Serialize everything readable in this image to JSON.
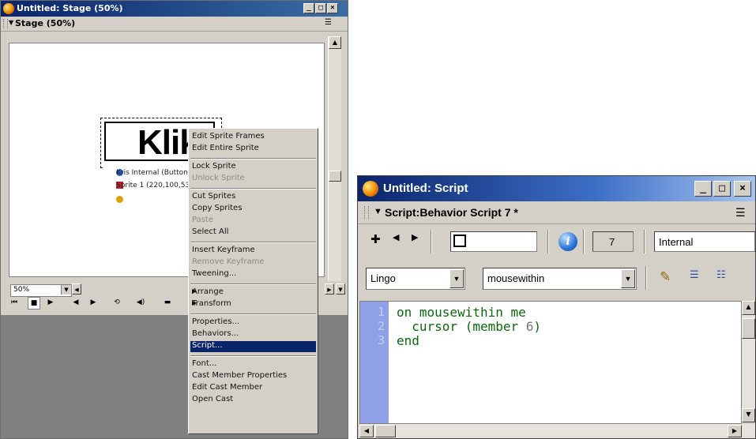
{
  "stage_window": {
    "title": "Untitled: Stage (50%)",
    "panel_title": "Stage (50%)",
    "sprite_text": "Klik",
    "sprite_info": {
      "name": "Kris Internal (Button",
      "coords": "Sprite 1 (220,100,532,3",
      "extra": ""
    },
    "zoom_value": "50%",
    "buttons": {
      "minimize": "_",
      "maximize": "□",
      "close": "×"
    }
  },
  "context_menu": {
    "items": [
      {
        "label": "Edit Sprite Frames",
        "enabled": true
      },
      {
        "label": "Edit Entire Sprite",
        "enabled": true
      },
      {
        "separator": true
      },
      {
        "label": "Lock Sprite",
        "enabled": true
      },
      {
        "label": "Unlock Sprite",
        "enabled": false
      },
      {
        "separator": true
      },
      {
        "label": "Cut Sprites",
        "enabled": true
      },
      {
        "label": "Copy Sprites",
        "enabled": true
      },
      {
        "label": "Paste",
        "enabled": false
      },
      {
        "label": "Select All",
        "enabled": true
      },
      {
        "separator": true
      },
      {
        "label": "Insert Keyframe",
        "enabled": true
      },
      {
        "label": "Remove Keyframe",
        "enabled": false
      },
      {
        "label": "Tweening...",
        "enabled": true
      },
      {
        "separator": true
      },
      {
        "label": "Arrange",
        "enabled": true,
        "submenu": true
      },
      {
        "label": "Transform",
        "enabled": true,
        "submenu": true
      },
      {
        "separator": true
      },
      {
        "label": "Properties...",
        "enabled": true
      },
      {
        "label": "Behaviors...",
        "enabled": true
      },
      {
        "label": "Script...",
        "enabled": true,
        "selected": true
      },
      {
        "separator": true
      },
      {
        "label": "Font...",
        "enabled": true
      },
      {
        "label": "Cast Member Properties",
        "enabled": true
      },
      {
        "label": "Edit Cast Member",
        "enabled": true
      },
      {
        "label": "Open Cast",
        "enabled": true
      }
    ]
  },
  "script_window": {
    "title": "Untitled: Script",
    "panel_title": "Script:Behavior Script 7 *",
    "member_number": "7",
    "cast_name": "Internal",
    "language": "Lingo",
    "handler": "mousewithin",
    "name_field": "",
    "code_lines": [
      {
        "num": "1",
        "text": "on mousewithin me"
      },
      {
        "num": "2",
        "text": "  cursor (member ",
        "arg": "6",
        "tail": ")"
      },
      {
        "num": "3",
        "text": "end"
      }
    ],
    "buttons": {
      "minimize": "_",
      "maximize": "□",
      "close": "×"
    }
  }
}
